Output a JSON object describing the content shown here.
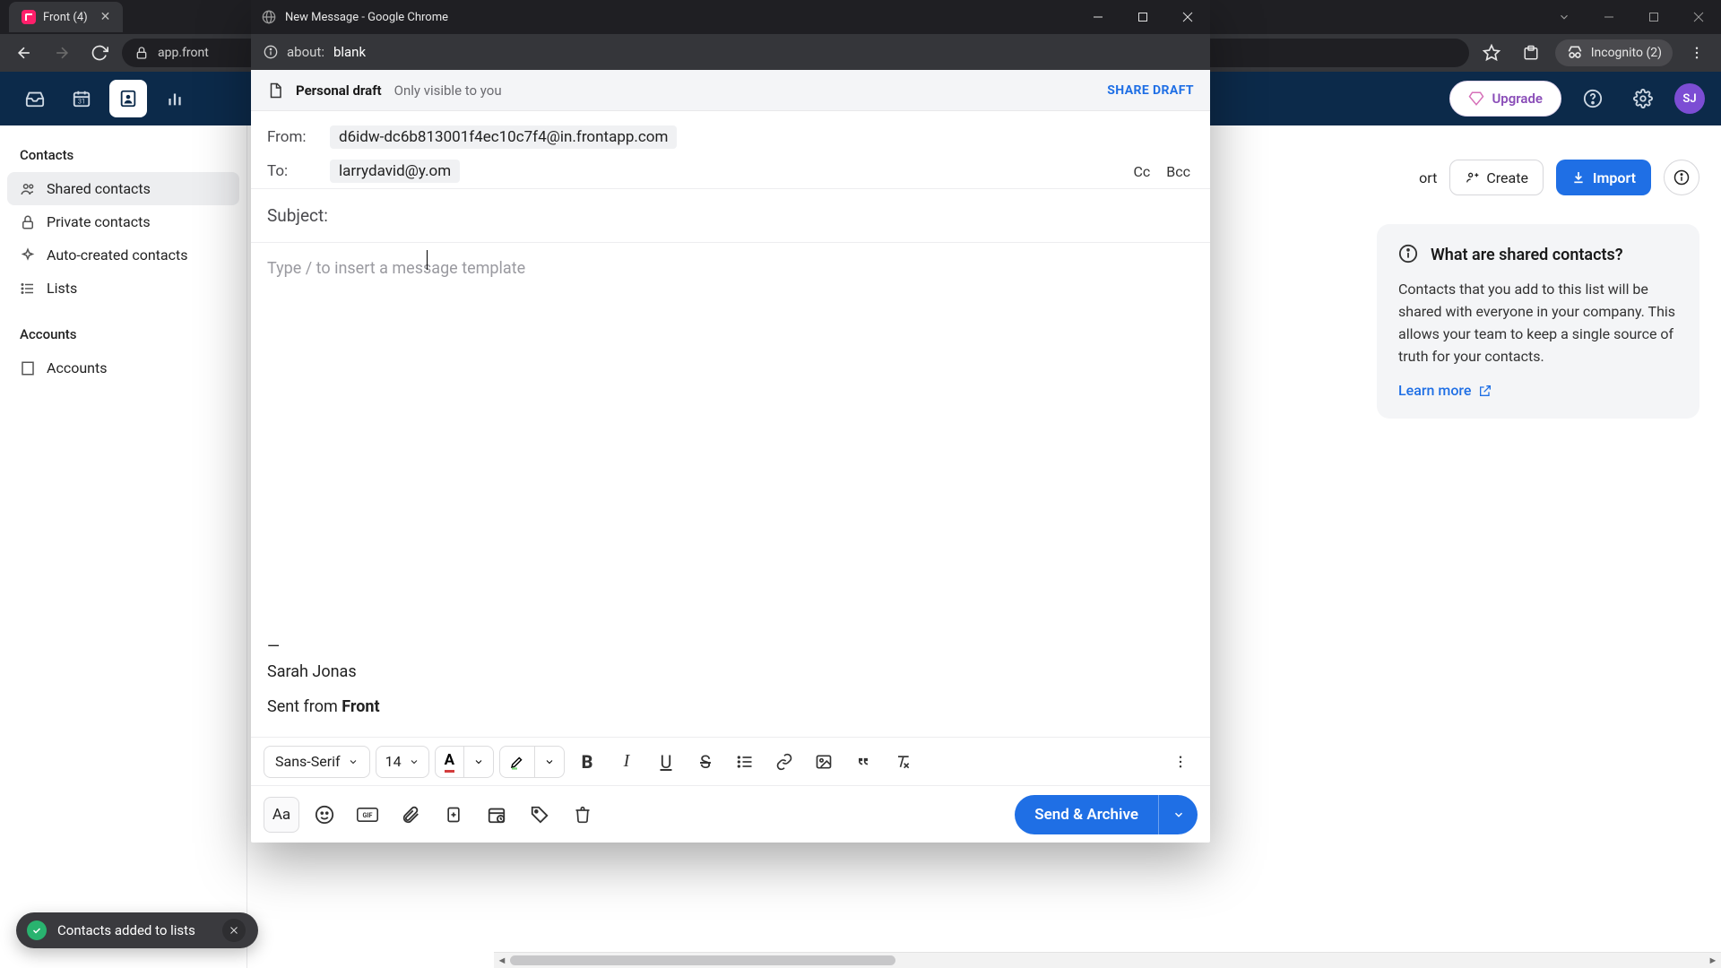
{
  "background_browser": {
    "tab_title": "Front (4)",
    "address_text": "app.front",
    "incognito_label": "Incognito (2)"
  },
  "front_app": {
    "upgrade_label": "Upgrade",
    "avatar_initials": "SJ",
    "sidebar": {
      "contacts_heading": "Contacts",
      "items": [
        "Shared contacts",
        "Private contacts",
        "Auto-created contacts",
        "Lists"
      ],
      "accounts_heading": "Accounts",
      "accounts_item": "Accounts"
    },
    "main_toolbar": {
      "export_label_fragment": "ort",
      "create_label": "Create",
      "import_label": "Import"
    },
    "info_card": {
      "title": "What are shared contacts?",
      "body": "Contacts that you add to this list will be shared with everyone in your company. This allows your team to keep a single source of truth for your contacts.",
      "link": "Learn more"
    }
  },
  "toast": {
    "message": "Contacts added to lists"
  },
  "compose_popup": {
    "window_title": "New Message - Google Chrome",
    "address_prefix": "about:",
    "address_page": "blank",
    "draft": {
      "badge": "Personal draft",
      "note": "Only visible to you",
      "share": "SHARE DRAFT"
    },
    "from_label": "From:",
    "from_value": "d6idw-dc6b813001f4ec10c7f4@in.frontapp.com",
    "to_label": "To:",
    "to_value": "larrydavid@y.om",
    "cc_label": "Cc",
    "bcc_label": "Bcc",
    "subject_label": "Subject:",
    "body_placeholder": "Type / to insert a message template",
    "signature": {
      "divider": "—",
      "name": "Sarah Jonas",
      "sent_from_prefix": "Sent from ",
      "sent_from_app": "Front"
    },
    "formatting": {
      "font_family": "Sans-Serif",
      "font_size": "14"
    },
    "send_label": "Send & Archive"
  }
}
